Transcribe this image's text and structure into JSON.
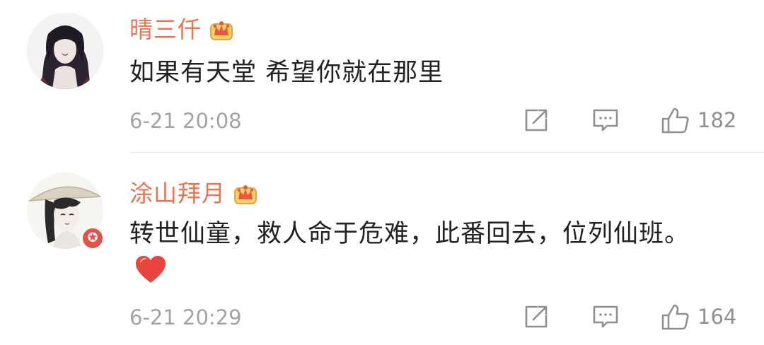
{
  "comments": [
    {
      "username": "晴三仟",
      "text": "如果有天堂 希望你就在那里",
      "timestamp": "6-21 20:08",
      "likes": "182",
      "avatar": "anime-character-avatar",
      "crown_icon": "vip-crown-icon"
    },
    {
      "username": "涂山拜月",
      "text": "转世仙童，救人命于危难，此番回去，位列仙班。",
      "emoji": "red-heart-icon",
      "timestamp": "6-21 20:29",
      "likes": "164",
      "avatar": "anime-girl-with-hat-avatar",
      "crown_icon": "vip-crown-icon",
      "badge_icon": "verified-star-icon"
    }
  ],
  "colors": {
    "username": "#eb7350",
    "text": "#222222",
    "meta": "#a3a3a3",
    "heart": "#e8453c",
    "badge": "#e3524a",
    "crown": "#f0a232"
  }
}
